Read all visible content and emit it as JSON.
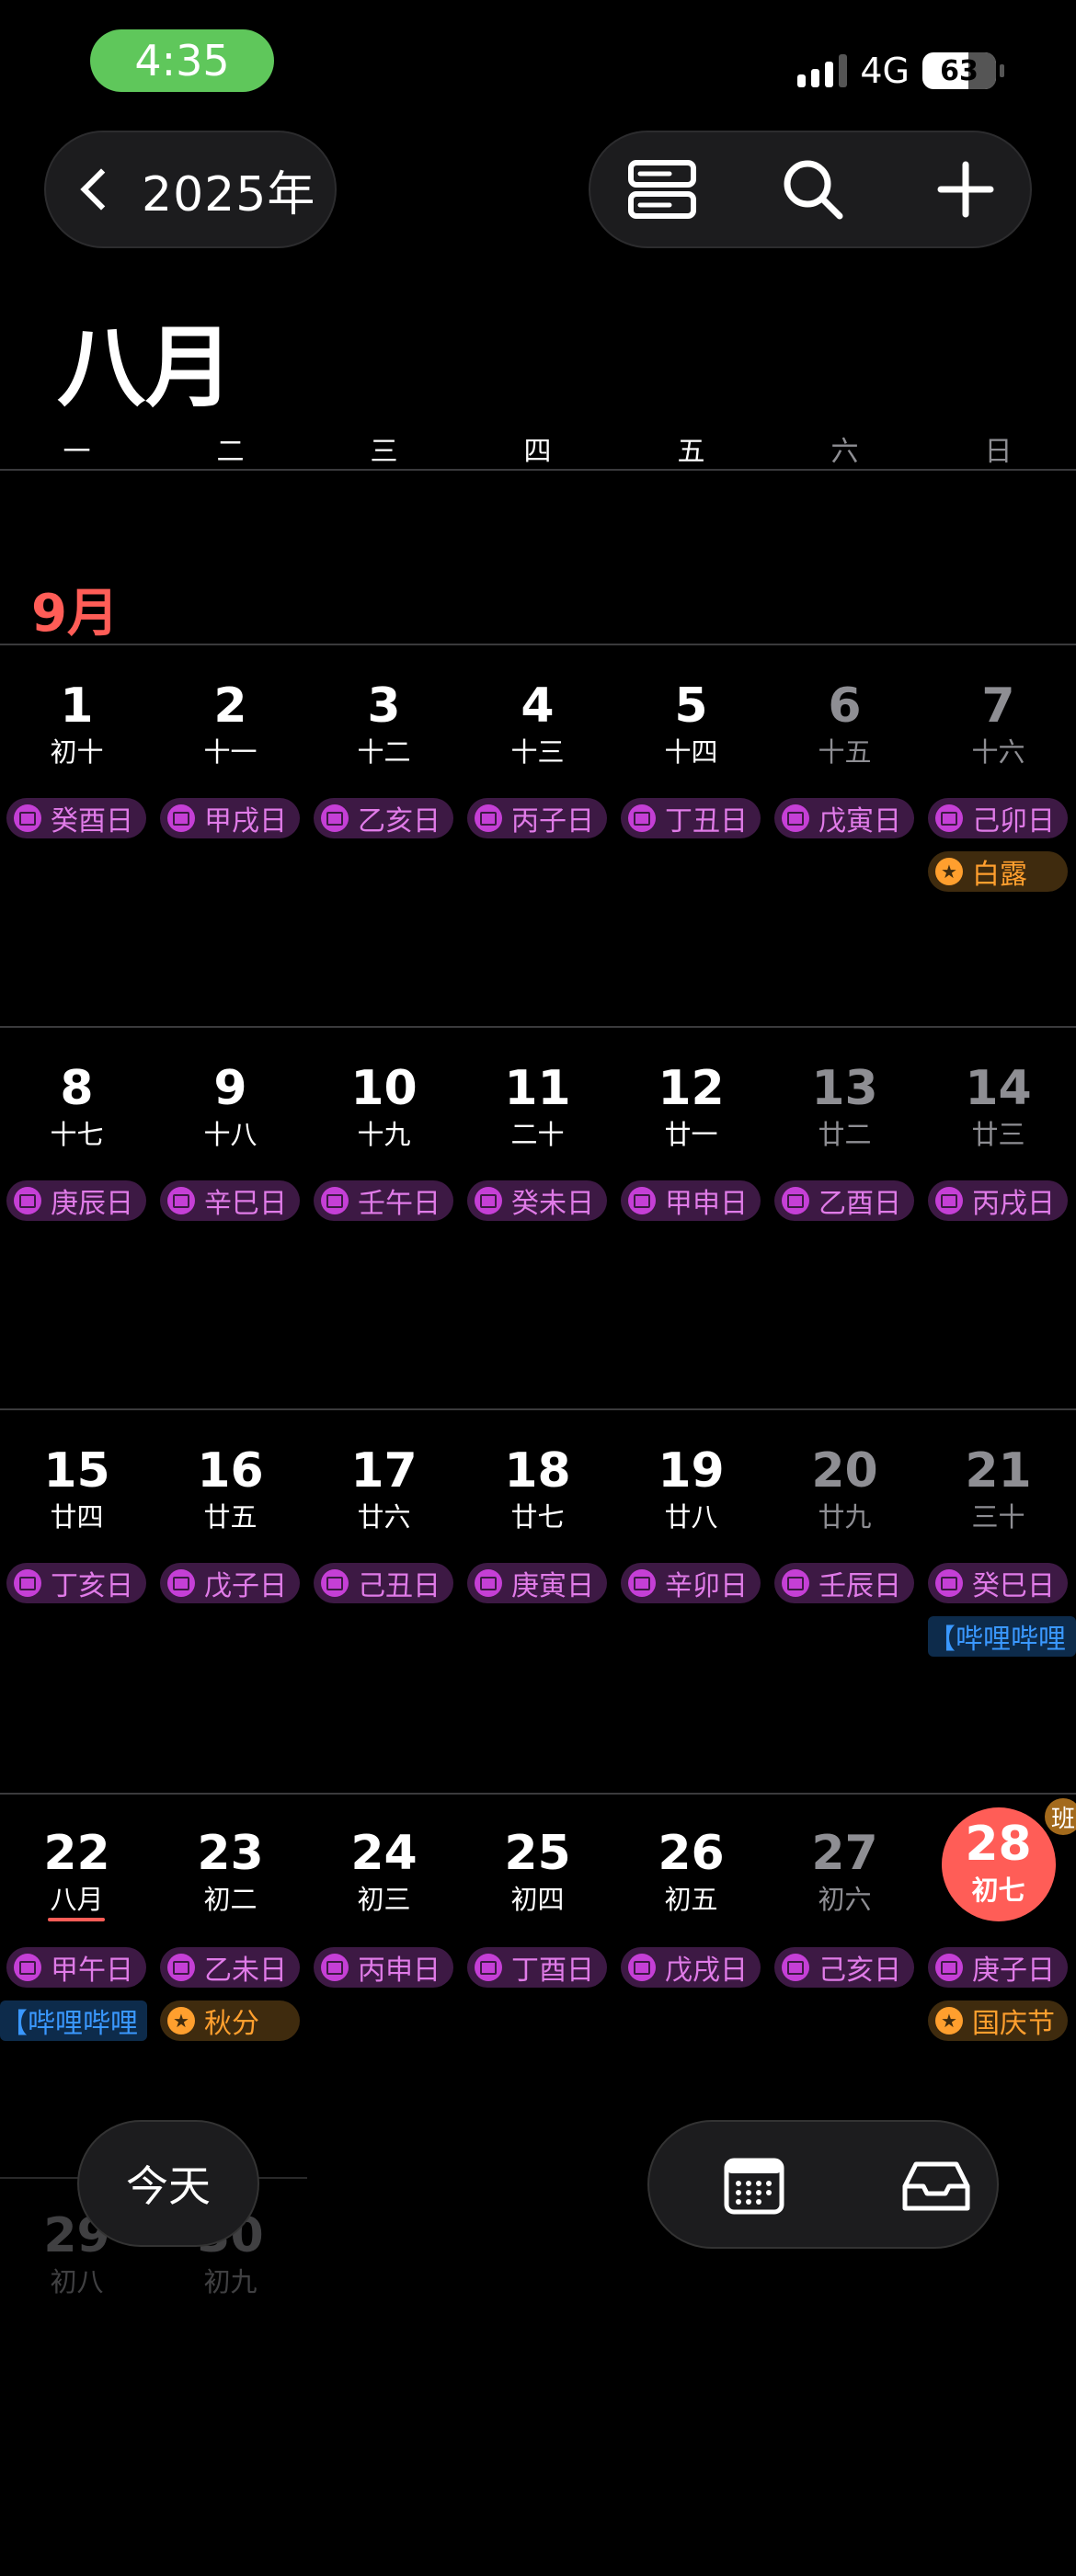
{
  "status_bar": {
    "time": "4:35",
    "network": "4G",
    "battery": "63"
  },
  "header": {
    "back_label": "2025年",
    "month_title": "八月"
  },
  "weekdays": [
    "一",
    "二",
    "三",
    "四",
    "五",
    "六",
    "日"
  ],
  "section_month": "9月",
  "weeks": [
    {
      "days": [
        {
          "num": "1",
          "lunar": "初十"
        },
        {
          "num": "2",
          "lunar": "十一"
        },
        {
          "num": "3",
          "lunar": "十二"
        },
        {
          "num": "4",
          "lunar": "十三"
        },
        {
          "num": "5",
          "lunar": "十四"
        },
        {
          "num": "6",
          "lunar": "十五"
        },
        {
          "num": "7",
          "lunar": "十六"
        }
      ]
    },
    {
      "days": [
        {
          "num": "8",
          "lunar": "十七"
        },
        {
          "num": "9",
          "lunar": "十八"
        },
        {
          "num": "10",
          "lunar": "十九"
        },
        {
          "num": "11",
          "lunar": "二十"
        },
        {
          "num": "12",
          "lunar": "廿一"
        },
        {
          "num": "13",
          "lunar": "廿二"
        },
        {
          "num": "14",
          "lunar": "廿三"
        }
      ]
    },
    {
      "days": [
        {
          "num": "15",
          "lunar": "廿四"
        },
        {
          "num": "16",
          "lunar": "廿五"
        },
        {
          "num": "17",
          "lunar": "廿六"
        },
        {
          "num": "18",
          "lunar": "廿七"
        },
        {
          "num": "19",
          "lunar": "廿八"
        },
        {
          "num": "20",
          "lunar": "廿九"
        },
        {
          "num": "21",
          "lunar": "三十"
        }
      ]
    },
    {
      "days": [
        {
          "num": "22",
          "lunar": "八月"
        },
        {
          "num": "23",
          "lunar": "初二"
        },
        {
          "num": "24",
          "lunar": "初三"
        },
        {
          "num": "25",
          "lunar": "初四"
        },
        {
          "num": "26",
          "lunar": "初五"
        },
        {
          "num": "27",
          "lunar": "初六"
        },
        {
          "num": "28",
          "lunar": "初七"
        }
      ]
    },
    {
      "days": [
        {
          "num": "29",
          "lunar": "初八"
        },
        {
          "num": "30",
          "lunar": "初九"
        }
      ]
    }
  ],
  "day_events": [
    [
      "癸酉日",
      "甲戌日",
      "乙亥日",
      "丙子日",
      "丁丑日",
      "戊寅日",
      "己卯日"
    ],
    [
      "庚辰日",
      "辛巳日",
      "壬午日",
      "癸未日",
      "甲申日",
      "乙酉日",
      "丙戌日"
    ],
    [
      "丁亥日",
      "戊子日",
      "己丑日",
      "庚寅日",
      "辛卯日",
      "壬辰日",
      "癸巳日"
    ],
    [
      "甲午日",
      "乙未日",
      "丙申日",
      "丁酉日",
      "戊戌日",
      "己亥日",
      "庚子日"
    ]
  ],
  "holidays": {
    "bailu": "白露",
    "qiufen": "秋分",
    "guoqing": "国庆节"
  },
  "bilibili": "【哔哩哔哩",
  "workday_badge": "班",
  "today_button": "今天",
  "colors": {
    "today": "#ff5d57",
    "event_bg": "#3d1944",
    "event_text": "#e07be8",
    "holiday": "#ff9f2e",
    "accent_blue": "#3a98ff",
    "status_green": "#5fc75b"
  },
  "icons": [
    "chevron-left-icon",
    "list-view-icon",
    "search-icon",
    "plus-icon",
    "calendar-icon",
    "inbox-icon",
    "star-icon",
    "signal-icon",
    "battery-icon"
  ]
}
